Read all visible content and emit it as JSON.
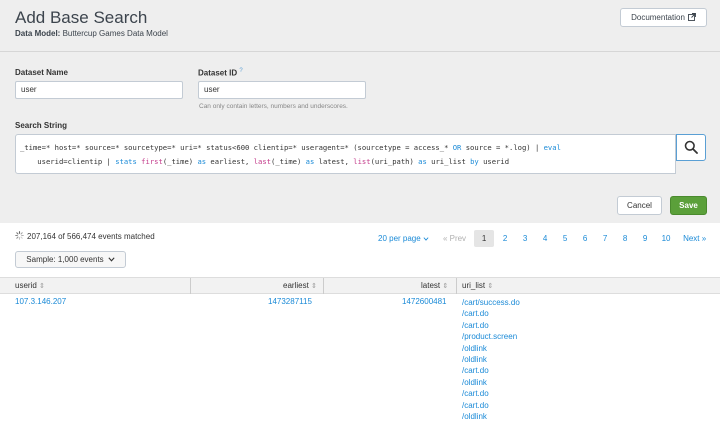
{
  "header": {
    "title": "Add Base Search",
    "subtitle_label": "Data Model:",
    "subtitle_value": "Buttercup Games Data Model",
    "doc_label": "Documentation"
  },
  "form": {
    "dataset_name_label": "Dataset Name",
    "dataset_name_value": "user",
    "dataset_id_label": "Dataset ID",
    "dataset_id_value": "user",
    "dataset_id_help": "Can only contain letters, numbers and underscores.",
    "search_string_label": "Search String"
  },
  "search": {
    "line1_a": "_time=* host=* source=* sourcetype=* uri=* status<600 clientip=* useragent=* (sourcetype = access_* ",
    "line1_or": "OR",
    "line1_b": " source = *.log) | ",
    "line1_eval": "eval",
    "line2_a": "    userid=clientip | ",
    "line2_stats": "stats",
    "line2_sp1": " ",
    "line2_first": "first",
    "line2_b": "(_time) ",
    "line2_as1": "as",
    "line2_c": " earliest, ",
    "line2_last": "last",
    "line2_d": "(_time) ",
    "line2_as2": "as",
    "line2_e": " latest, ",
    "line2_list": "list",
    "line2_f": "(uri_path) ",
    "line2_as3": "as",
    "line2_g": " uri_list ",
    "line2_by": "by",
    "line2_h": " userid"
  },
  "actions": {
    "cancel": "Cancel",
    "save": "Save"
  },
  "results": {
    "events_matched": "207,164 of 566,474 events matched",
    "sample_label": "Sample: 1,000 events",
    "per_page": "20 per page",
    "prev": "« Prev",
    "pages": [
      "1",
      "2",
      "3",
      "4",
      "5",
      "6",
      "7",
      "8",
      "9",
      "10"
    ],
    "current_page": "1",
    "next": "Next »"
  },
  "table": {
    "columns": [
      "userid",
      "earliest",
      "latest",
      "uri_list"
    ],
    "row": {
      "userid": "107.3.146.207",
      "earliest": "1473287115",
      "latest": "1472600481",
      "uri_list": [
        "/cart/success.do",
        "/cart.do",
        "/cart.do",
        "/product.screen",
        "/oldlink",
        "/oldlink",
        "/cart.do",
        "/oldlink",
        "/cart.do",
        "/cart.do",
        "/oldlink"
      ]
    }
  }
}
